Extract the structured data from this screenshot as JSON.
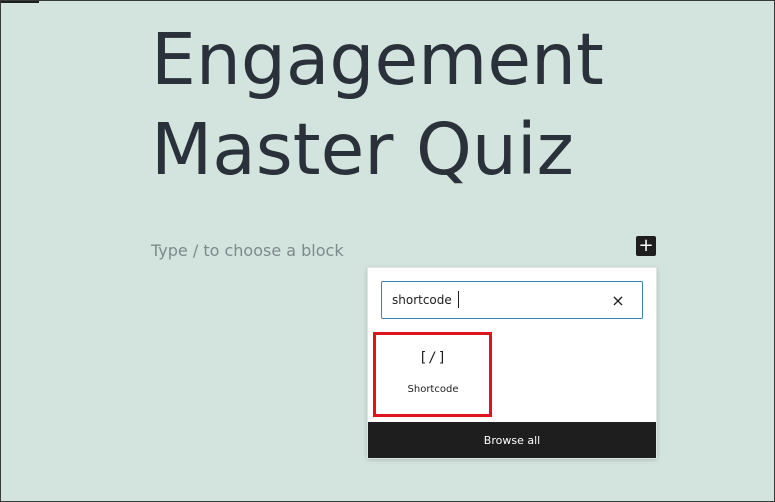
{
  "post": {
    "title": "Engagement Master Quiz",
    "block_placeholder": "Type / to choose a block"
  },
  "toolbar": {
    "add_block_icon": "plus-icon",
    "add_block_symbol": "+"
  },
  "inserter": {
    "search": {
      "value": "shortcode",
      "clear_symbol": "×"
    },
    "results": [
      {
        "icon": "shortcode-icon",
        "icon_text": "[/]",
        "label": "Shortcode"
      }
    ],
    "browse_all_label": "Browse all"
  },
  "colors": {
    "background": "#d2e4dd",
    "title": "#2b313b",
    "accent": "#3582c4",
    "highlight": "#e0141e",
    "dark": "#1e1e1e"
  }
}
